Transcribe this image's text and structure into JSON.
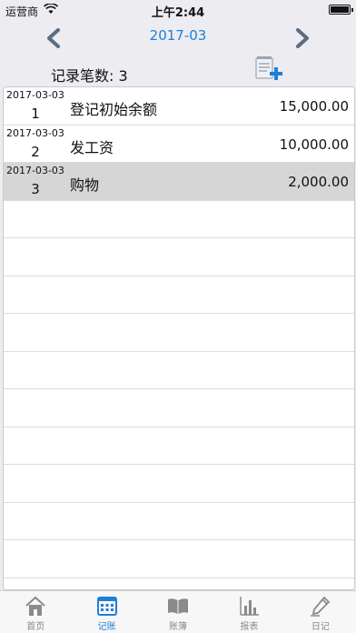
{
  "status": {
    "carrier": "运营商",
    "time": "上午2:44"
  },
  "nav": {
    "title": "2017-03"
  },
  "summary": {
    "count_label": "记录笔数: 3"
  },
  "records": [
    {
      "date": "2017-03-03",
      "num": "1",
      "desc": "登记初始余额",
      "amount": "15,000.00"
    },
    {
      "date": "2017-03-03",
      "num": "2",
      "desc": "发工资",
      "amount": "10,000.00"
    },
    {
      "date": "2017-03-03",
      "num": "3",
      "desc": "购物",
      "amount": "2,000.00"
    }
  ],
  "selected_row": 2,
  "tabs": [
    {
      "label": "首页",
      "icon": "home-icon"
    },
    {
      "label": "记账",
      "icon": "calendar-grid-icon"
    },
    {
      "label": "账簿",
      "icon": "book-icon"
    },
    {
      "label": "报表",
      "icon": "bar-chart-icon"
    },
    {
      "label": "日记",
      "icon": "pencil-icon"
    }
  ],
  "active_tab": 1,
  "colors": {
    "accent": "#1f7fd9",
    "chevron": "#5a6e82",
    "selected_row": "#d6d6d6"
  }
}
